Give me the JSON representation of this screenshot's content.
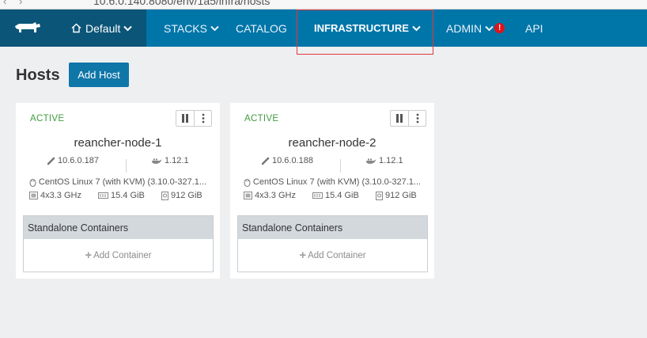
{
  "browser": {
    "url_text": "10.6.0.140:8080/env/1a5/infra/hosts"
  },
  "header": {
    "environment_label": "Default",
    "nav": [
      {
        "label": "STACKS",
        "has_dropdown": true
      },
      {
        "label": "CATALOG",
        "has_dropdown": false
      },
      {
        "label": "INFRASTRUCTURE",
        "has_dropdown": true,
        "active": true
      },
      {
        "label": "ADMIN",
        "has_dropdown": true,
        "alert": "!"
      },
      {
        "label": "API",
        "has_dropdown": false
      }
    ]
  },
  "page": {
    "title": "Hosts",
    "add_button_label": "Add Host"
  },
  "hosts": [
    {
      "state": "ACTIVE",
      "name": "reancher-node-1",
      "ip": "10.6.0.187",
      "docker_version": "1.12.1",
      "os": "CentOS Linux 7 (with KVM) (3.10.0-327.1...",
      "cpu": "4x3.3 GHz",
      "memory": "15.4 GiB",
      "storage": "912 GiB",
      "containers_title": "Standalone Containers",
      "add_container_label": "Add Container"
    },
    {
      "state": "ACTIVE",
      "name": "reancher-node-2",
      "ip": "10.6.0.188",
      "docker_version": "1.12.1",
      "os": "CentOS Linux 7 (with KVM) (3.10.0-327.1...",
      "cpu": "4x3.3 GHz",
      "memory": "15.4 GiB",
      "storage": "912 GiB",
      "containers_title": "Standalone Containers",
      "add_container_label": "Add Container"
    }
  ],
  "colors": {
    "header_bg": "#0075a8",
    "header_dark": "#0b5578",
    "active_state": "#3f9b3f",
    "button_bg": "#0f76a8",
    "highlight": "#e03a3a"
  }
}
